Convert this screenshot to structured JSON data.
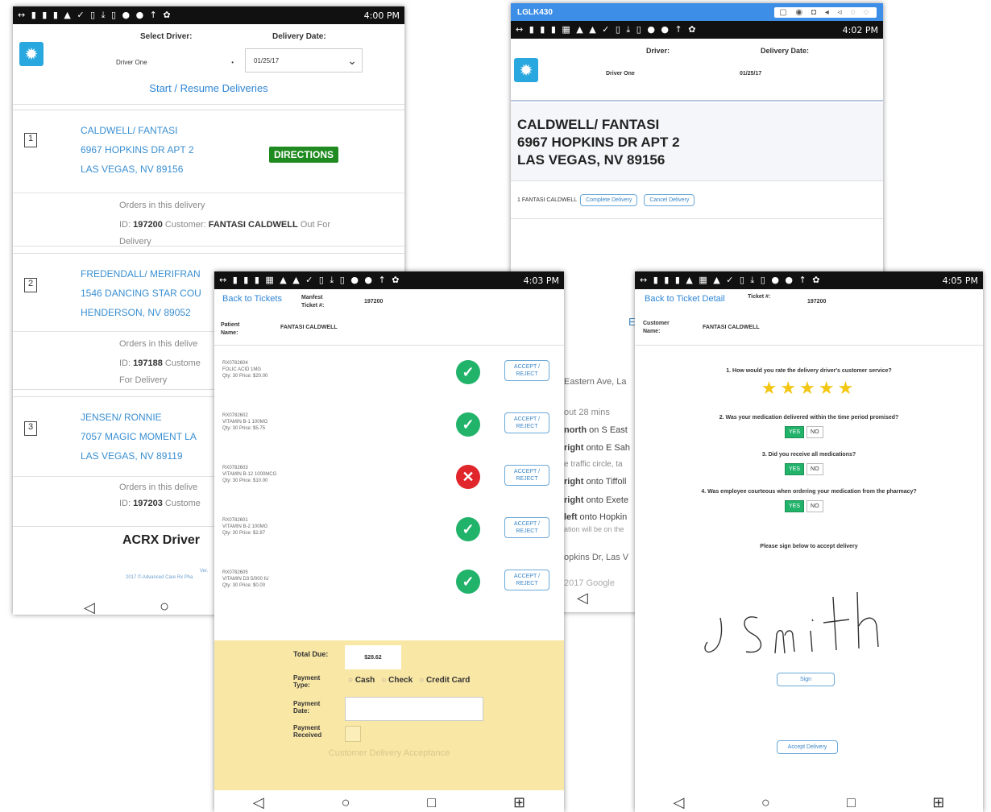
{
  "screen1": {
    "status_icons": "↔ ▮ ▮ ▮ ▲ ✓ ▯ ⤓ ▯ ● ● ↑ ✿",
    "status_time": "4:00 PM",
    "select_driver_label": "Select Driver:",
    "delivery_date_label": "Delivery Date:",
    "driver_value": "Driver One",
    "date_value": "01/25/17",
    "start_button": "Start / Resume Deliveries",
    "deliveries": [
      {
        "num": "1",
        "name": "CALDWELL/ FANTASI",
        "street": "6967 HOPKINS DR APT 2",
        "city": "LAS VEGAS, NV 89156",
        "orders_label": "Orders in this delivery",
        "id_prefix": "ID: ",
        "id": "197200",
        "customer_prefix": " Customer: ",
        "customer": "FANTASI CALDWELL",
        "status_line1": " Out For",
        "status_line2": "Delivery"
      },
      {
        "num": "2",
        "name": "FREDENDALL/ MERIFRAN",
        "street": "1546 DANCING STAR COU",
        "city": "HENDERSON, NV 89052",
        "orders_label": "Orders in this delive",
        "id_prefix": "ID: ",
        "id": "197188",
        "customer_prefix": " Custome",
        "status_line2": "For Delivery"
      },
      {
        "num": "3",
        "name": "JENSEN/ RONNIE",
        "street": "7057 MAGIC MOMENT LA",
        "city": "LAS VEGAS, NV 89119",
        "orders_label": "Orders in this delive",
        "id_prefix": "ID: ",
        "id": "197203",
        "customer_prefix": " Custome"
      }
    ],
    "directions_button": "DIRECTIONS",
    "footer_title": "ACRX Driver",
    "footer_small1": "Ver.",
    "footer_small2": "2017 © Advanced Care Rx Pha",
    "nav_back": "◁",
    "nav_home": "○"
  },
  "screen2": {
    "titlebar": "LGLK430",
    "titlebar_controls": "▢ ◉ ◘ ◂ ◃ ◌ ◌",
    "status_icons": "↔ ▮ ▮ ▮ ▦ ▲ ▲ ✓ ▯ ⤓ ▯ ● ● ↑ ✿",
    "status_time": "4:02 PM",
    "driver_label": "Driver:",
    "delivery_date_label": "Delivery Date:",
    "driver_value": "Driver One",
    "date_value": "01/25/17",
    "addr_line1": "CALDWELL/ FANTASI",
    "addr_line2": "6967 HOPKINS DR APT 2",
    "addr_line3": "LAS VEGAS, NV  89156",
    "patient_line": "1 FANTASI CALDWELL",
    "complete_button": "Complete Delivery",
    "cancel_button": "Cancel Delivery",
    "map_partial_e": "E",
    "directions": [
      {
        "text": "Eastern Ave, La"
      },
      {
        "text": "out 28 mins"
      },
      {
        "bold": "north",
        "text": " on S East"
      },
      {
        "bold": "right",
        "text": " onto E Sah"
      },
      {
        "text": "e traffic circle, ta"
      },
      {
        "bold": "right",
        "text": " onto Tiffoll"
      },
      {
        "bold": "right",
        "text": " onto Exete"
      },
      {
        "bold": "left",
        "text": " onto Hopkin"
      },
      {
        "text": "ation will be on the"
      },
      {
        "text": "opkins Dr, Las V"
      },
      {
        "text": "2017 Google"
      }
    ],
    "nav_back": "◁"
  },
  "screen3": {
    "status_icons": "↔ ▮ ▮ ▮ ▦ ▲ ▲ ✓ ▯ ⤓ ▯ ● ● ↑ ✿",
    "status_time": "4:03 PM",
    "back_link": "Back to Tickets",
    "manifest_label": "Manfest Ticket #:",
    "manifest_value": "197200",
    "patient_label": "Patient Name:",
    "patient_value": "FANTASI CALDWELL",
    "items": [
      {
        "rx": "RX0782604",
        "name": "FOLIC ACID 1MG",
        "qty": "Qty: 30 Price: $20.00",
        "status": "accepted"
      },
      {
        "rx": "RX0782602",
        "name": "VITAMIN B-1 100MG",
        "qty": "Qty: 30 Price: $5.75",
        "status": "accepted"
      },
      {
        "rx": "RX0782603",
        "name": "VITAMIN B-12 1000MCG",
        "qty": "Qty: 30 Price: $10.00",
        "status": "rejected"
      },
      {
        "rx": "RX0782601",
        "name": "VITAMIN B-2 100MG",
        "qty": "Qty: 30 Price: $2.87",
        "status": "accepted"
      },
      {
        "rx": "RX0782605",
        "name": "VITAMIN D3 5/000 IU",
        "qty": "Qty: 30 Price: $0.00",
        "status": "accepted"
      }
    ],
    "accept_reject_label": "ACCEPT / REJECT",
    "total_due_label": "Total Due:",
    "total_due_value": "$28.62",
    "payment_type_label": "Payment Type:",
    "payment_options": [
      "Cash",
      "Check",
      "Credit Card"
    ],
    "payment_date_label": "Payment Date:",
    "payment_received_label": "Payment Received",
    "acceptance_button": "Customer Delivery Acceptance",
    "nav": [
      "◁",
      "○",
      "□",
      "⊞"
    ]
  },
  "screen4": {
    "status_icons": "↔ ▮ ▮ ▮ ▲ ▦ ▲ ✓ ▯ ⤓ ▯ ● ● ↑ ✿",
    "status_time": "4:05 PM",
    "back_link": "Back to Ticket Detail",
    "ticket_label": "Ticket #:",
    "ticket_value": "197200",
    "customer_label": "Customer Name:",
    "customer_value": "FANTASI CALDWELL",
    "q1": "1. How would you rate the delivery driver's customer service?",
    "rating": 5,
    "q2": "2. Was your medication delivered within the time period promised?",
    "q3": "3. Did you receive all medications?",
    "q4": "4. Was employee courteous when ordering your medication from the pharmacy?",
    "yes_label": "YES",
    "no_label": "NO",
    "sign_prompt": "Please sign below to accept delivery",
    "sign_button": "Sign",
    "accept_button": "Accept Delivery",
    "nav": [
      "◁",
      "○",
      "□",
      "⊞"
    ]
  },
  "colors": {
    "link_blue": "#2f86d6",
    "accept_green": "#22b36a",
    "reject_red": "#e0262b",
    "payment_panel": "#f9e7a6",
    "directions_green": "#1f8a1f"
  }
}
